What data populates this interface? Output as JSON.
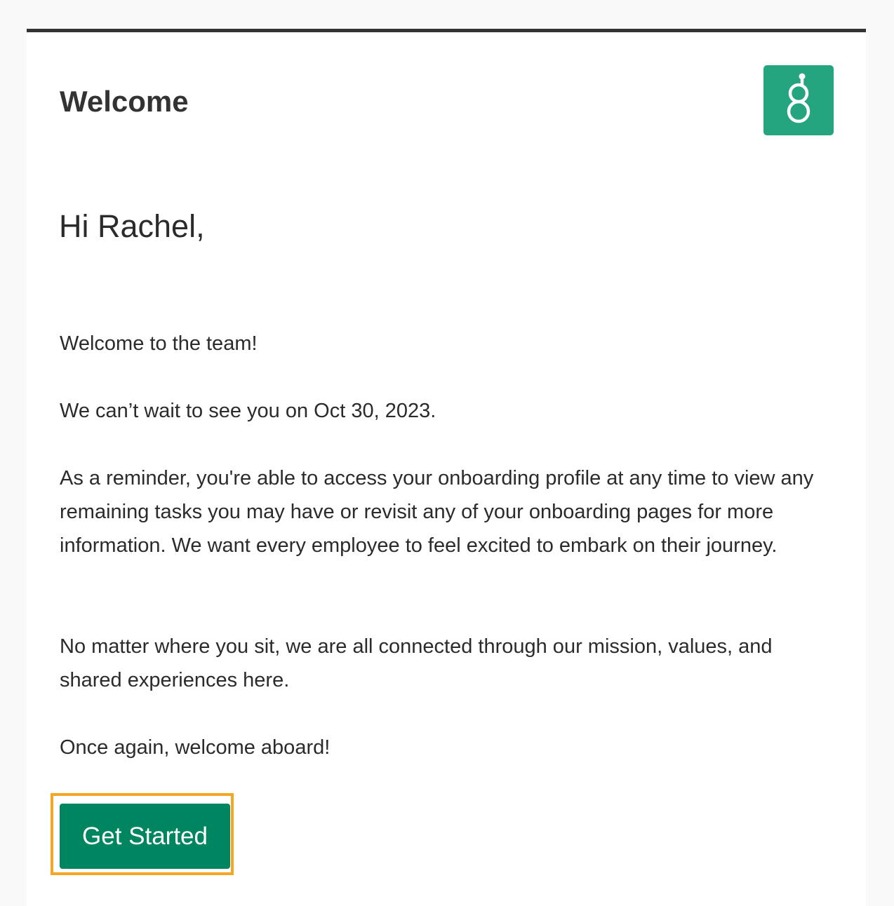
{
  "header": {
    "title": "Welcome",
    "logo_icon": "greenhouse-g-logo-icon",
    "logo_color": "#24a47f"
  },
  "greeting": "Hi Rachel,",
  "body": {
    "paragraphs": [
      "Welcome to the team!",
      "We can’t wait to see you on Oct 30, 2023.",
      "As a reminder, you're able to access your onboarding profile at any time to view any remaining tasks you may have or revisit any of your onboarding pages for more information. We want every employee to feel excited to embark on their journey.",
      "No matter where you sit, we are all connected through our mission, values, and shared experiences here.",
      "Once again, welcome aboard!"
    ]
  },
  "cta": {
    "label": "Get Started",
    "color": "#008561",
    "highlight_color": "#f5a623"
  },
  "colors": {
    "top_border": "#333333",
    "background": "#f9f9f9"
  }
}
